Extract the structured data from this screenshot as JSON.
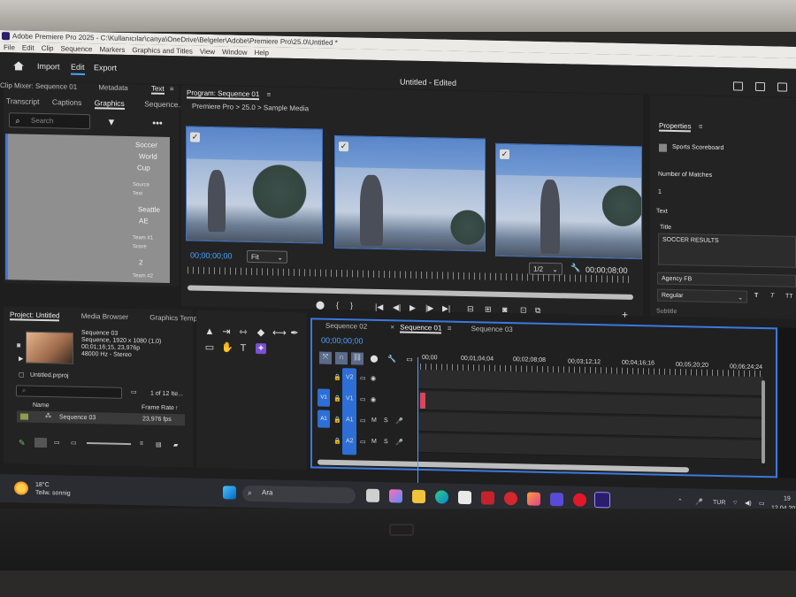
{
  "window": {
    "title": "Adobe Premiere Pro 2025 - C:\\Kullanıcılar\\canya\\OneDrive\\Belgeler\\Adobe\\Premiere Pro\\25.0\\Untitled *"
  },
  "menu": [
    "File",
    "Edit",
    "Clip",
    "Sequence",
    "Markers",
    "Graphics and Titles",
    "View",
    "Window",
    "Help"
  ],
  "header": {
    "import": "Import",
    "edit": "Edit",
    "export": "Export",
    "doc_title": "Untitled - Edited"
  },
  "left_panel": {
    "tabs": [
      "Clip Mixer: Sequence 01",
      "Metadata",
      "Text"
    ],
    "subtabs": [
      "Transcript",
      "Captions",
      "Graphics",
      "Sequence..."
    ],
    "search_placeholder": "Search",
    "params": {
      "title_value": [
        "Soccer",
        "World",
        "Cup"
      ],
      "source_text_label": [
        "Source",
        "Text"
      ],
      "team1_name": [
        "Seattle",
        "AE"
      ],
      "team1_score_label": [
        "Team #1",
        "Score"
      ],
      "team1_score": "2",
      "team2_label": "Team #2"
    }
  },
  "program": {
    "tab": "Program: Sequence 01",
    "breadcrumb": "Premiere Pro  >  25.0  >  Sample Media",
    "timecode_left": "00;00;00;00",
    "fit": "Fit",
    "resolution": "1/2",
    "timecode_right": "00;00;08;00"
  },
  "properties": {
    "tab": "Properties",
    "item": "Sports Scoreboard",
    "matches_label": "Number of Matches",
    "matches_value": "1",
    "text_label": "Text",
    "title_label": "Title",
    "title_value": "SOCCER RESULTS",
    "font": "Agency FB",
    "style": "Regular",
    "subtitle": "Subtitle"
  },
  "project": {
    "tabs": [
      "Project: Untitled",
      "Media Browser",
      "Graphics Templ"
    ],
    "seq_name": "Sequence 03",
    "seq_res": "Sequence, 1920 x 1080 (1,0)",
    "seq_dur": "00;01;16;15, 23,976p",
    "seq_audio": "48000 Hz - Stereo",
    "file": "Untitled.prproj",
    "count": "1 of 12 Ite...",
    "col_name": "Name",
    "col_rate": "Frame Rate",
    "row_name": "Sequence 03",
    "row_rate": "23,976 fps"
  },
  "timeline": {
    "tabs": [
      "Sequence 02",
      "Sequence 01",
      "Sequence 03"
    ],
    "timecode": "00;00;00;00",
    "ruler": [
      "00;00",
      "00;01;04;04",
      "00;02;08;08",
      "00;03;12;12",
      "00;04;16;16",
      "00;05;20;20",
      "00;06;24;24"
    ],
    "tracks": [
      "V2",
      "V1",
      "A1",
      "A2"
    ],
    "targets": [
      "V1",
      "A1"
    ],
    "mute": "M",
    "solo": "S"
  },
  "taskbar": {
    "temp": "18°C",
    "weather": "Teilw. sonnig",
    "search": "Ara",
    "lang": "TUR",
    "time": "19",
    "date": "12.04.20"
  },
  "colors": {
    "accent_blue": "#3b79e0",
    "timecode_blue": "#4aa3ff",
    "clip_red": "#d9455f"
  }
}
